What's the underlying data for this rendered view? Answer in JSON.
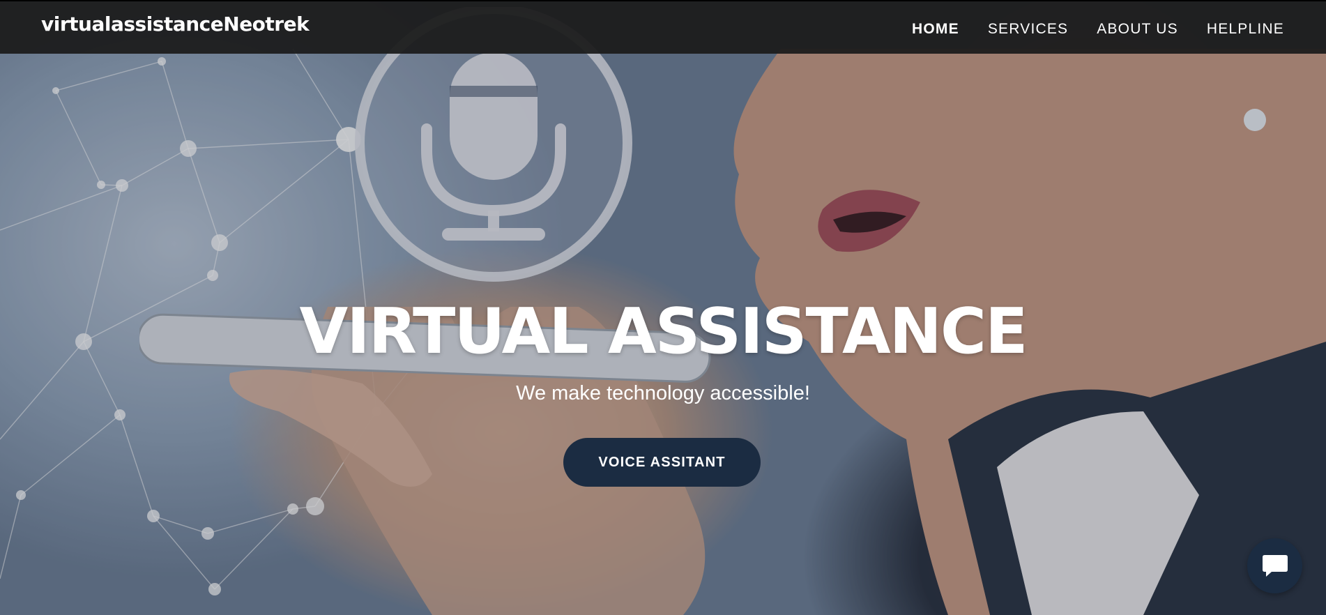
{
  "brand": {
    "name": "virtualassistanceNeotrek"
  },
  "nav": {
    "items": [
      {
        "label": "HOME",
        "active": true
      },
      {
        "label": "SERVICES",
        "active": false
      },
      {
        "label": "ABOUT US",
        "active": false
      },
      {
        "label": "HELPLINE",
        "active": false
      }
    ]
  },
  "hero": {
    "title": "VIRTUAL ASSISTANCE",
    "subtitle": "We make technology accessible!",
    "cta_label": "VOICE ASSITANT",
    "background_image": "woman speaking into smartphone with microphone icon and network graph overlay"
  },
  "chat": {
    "icon": "chat-bubble-icon"
  },
  "colors": {
    "navbar_bg": "#1c1c1c",
    "button_bg": "#1b2c42",
    "text": "#ffffff"
  }
}
